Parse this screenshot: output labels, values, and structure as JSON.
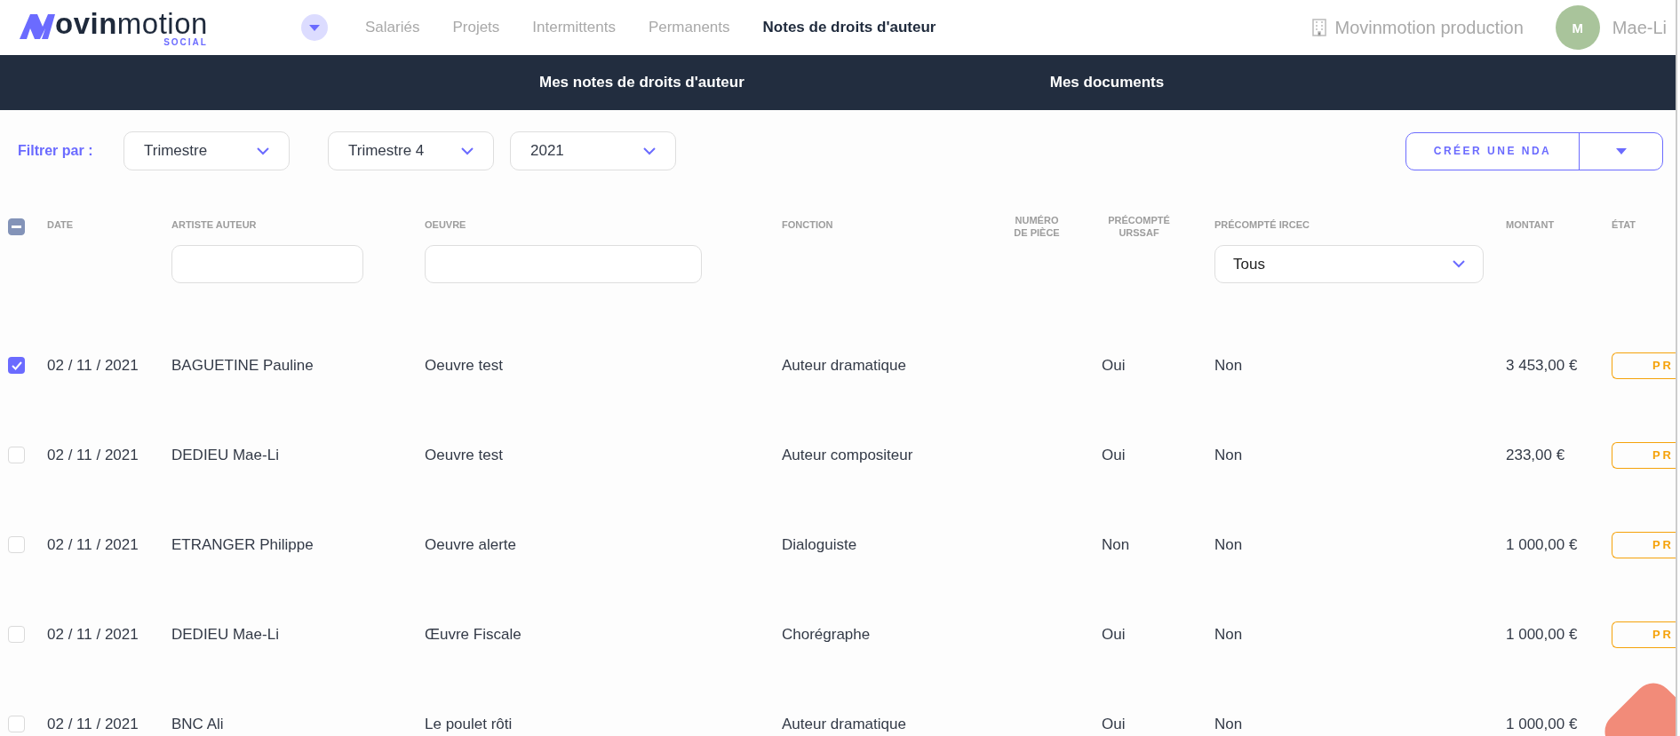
{
  "logo": {
    "wordmark": "**ovin**motion",
    "tagline": "SOCIAL"
  },
  "nav": [
    {
      "label": "Salariés",
      "selected": false
    },
    {
      "label": "Projets",
      "selected": false
    },
    {
      "label": "Intermittents",
      "selected": false
    },
    {
      "label": "Permanents",
      "selected": false
    },
    {
      "label": "Notes de droits d'auteur",
      "selected": true
    }
  ],
  "company": "Movinmotion production",
  "user": {
    "initial": "M",
    "name": "Mae-Li"
  },
  "subnav": [
    "Mes notes de droits d'auteur",
    "Mes documents"
  ],
  "filters": {
    "label": "Filtrer par :",
    "selects": [
      "Trimestre",
      "Trimestre 4",
      "2021"
    ]
  },
  "create_button": "CRÉER UNE NDA",
  "table": {
    "all_partial": true,
    "columns": [
      "DATE",
      "ARTISTE AUTEUR",
      "OEUVRE",
      "FONCTION",
      "NUMÉRO DE PIÈCE",
      "PRÉCOMPTÉ URSSAF",
      "PRÉCOMPTÉ IRCEC",
      "MONTANT",
      "ÉTAT"
    ],
    "ircec_filter": "Tous",
    "rows": [
      {
        "checked": true,
        "date": "02 / 11 / 2021",
        "artist": "BAGUETINE Pauline",
        "work": "Oeuvre test",
        "function": "Auteur dramatique",
        "urssaf": "Oui",
        "ircec": "Non",
        "amount": "3 453,00 €",
        "state": "PR"
      },
      {
        "checked": false,
        "date": "02 / 11 / 2021",
        "artist": "DEDIEU Mae-Li",
        "work": "Oeuvre test",
        "function": "Auteur compositeur",
        "urssaf": "Oui",
        "ircec": "Non",
        "amount": "233,00 €",
        "state": "PR"
      },
      {
        "checked": false,
        "date": "02 / 11 / 2021",
        "artist": "ETRANGER Philippe",
        "work": "Oeuvre alerte",
        "function": "Dialoguiste",
        "urssaf": "Non",
        "ircec": "Non",
        "amount": "1 000,00 €",
        "state": "PR"
      },
      {
        "checked": false,
        "date": "02 / 11 / 2021",
        "artist": "DEDIEU Mae-Li",
        "work": "Œuvre Fiscale",
        "function": "Chorégraphe",
        "urssaf": "Oui",
        "ircec": "Non",
        "amount": "1 000,00 €",
        "state": "PR"
      },
      {
        "checked": false,
        "date": "02 / 11 / 2021",
        "artist": "BNC Ali",
        "work": "Le poulet rôti",
        "function": "Auteur dramatique",
        "urssaf": "Oui",
        "ircec": "Non",
        "amount": "1 000,00 €"
      }
    ]
  }
}
